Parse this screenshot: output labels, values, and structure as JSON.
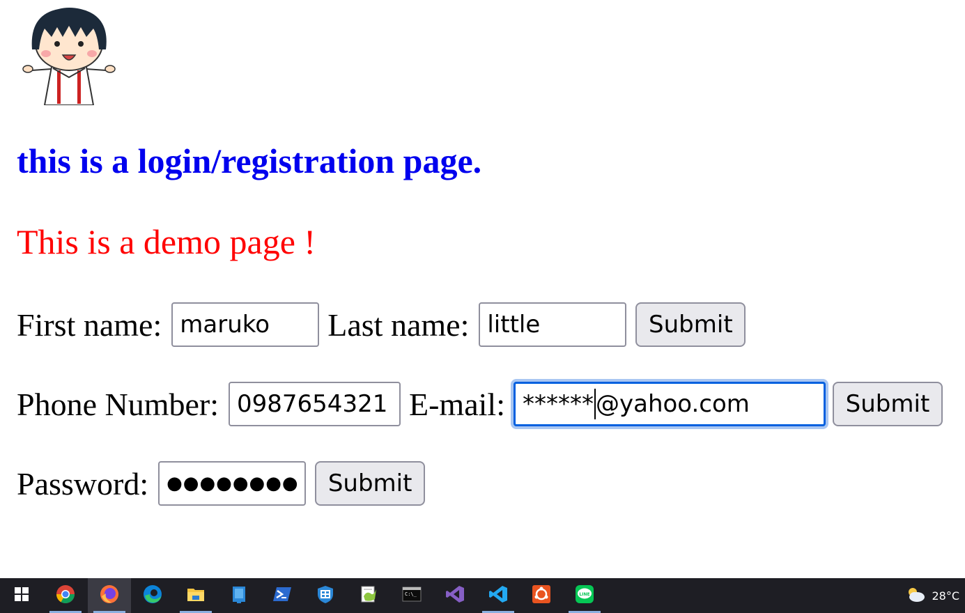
{
  "page": {
    "heading": "this is a login/registration page.",
    "subtitle": "This is a demo page !"
  },
  "form": {
    "first_name_label": "First name:",
    "first_name_value": "maruko",
    "last_name_label": "Last name:",
    "last_name_value": "little",
    "submit1_label": "Submit",
    "phone_label": "Phone Number:",
    "phone_value": "0987654321",
    "email_label": "E-mail:",
    "email_value_before_caret": "******",
    "email_value_after_caret": "@yahoo.com",
    "submit2_label": "Submit",
    "password_label": "Password:",
    "password_mask": "●●●●●●●●",
    "submit3_label": "Submit"
  },
  "taskbar": {
    "items": [
      {
        "icon": "windows-start-icon"
      },
      {
        "icon": "chrome-icon"
      },
      {
        "icon": "firefox-icon",
        "active": true
      },
      {
        "icon": "edge-icon"
      },
      {
        "icon": "file-explorer-icon"
      },
      {
        "icon": "windows-sandbox-icon"
      },
      {
        "icon": "powershell-icon"
      },
      {
        "icon": "security-shield-icon"
      },
      {
        "icon": "notepad-plus-plus-icon"
      },
      {
        "icon": "terminal-icon"
      },
      {
        "icon": "visual-studio-icon"
      },
      {
        "icon": "vscode-icon"
      },
      {
        "icon": "ubuntu-icon"
      },
      {
        "icon": "line-icon"
      }
    ],
    "weather_icon": "cloudy-sun-icon",
    "temperature": "28°C"
  },
  "colors": {
    "heading": "#0000ee",
    "subtitle": "#ff0000",
    "focus_ring": "#0060df",
    "taskbar_bg": "#1e1e24"
  }
}
